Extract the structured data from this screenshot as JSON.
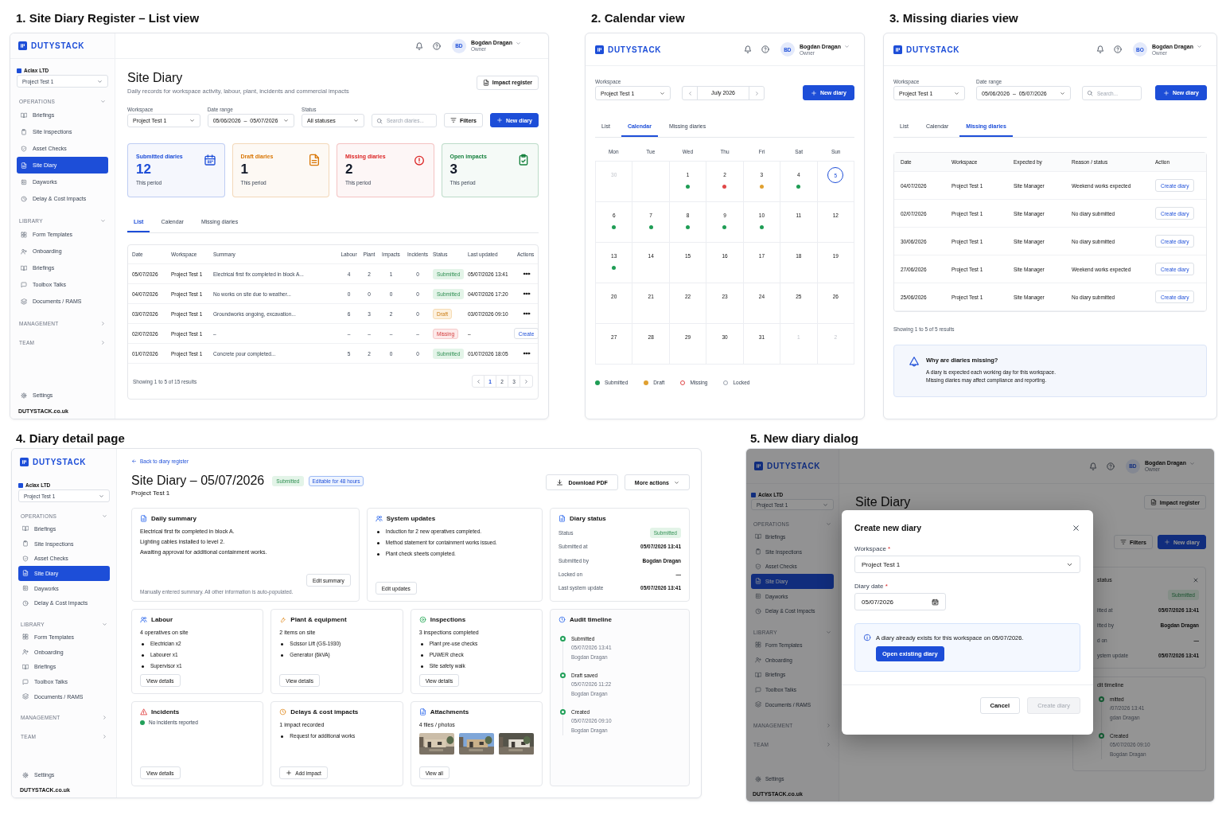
{
  "views": [
    {
      "kind": "list",
      "heading": "1. Site Diary Register – List view",
      "header": {
        "brand": "DUTYSTACK",
        "avatar": "BD",
        "user": "Bogdan Dragan",
        "role": "Owner"
      },
      "sidebar": {
        "org": "Aclax LTD",
        "project": "Project Test 1",
        "groups": [
          {
            "label": "OPERATIONS",
            "expanded": true,
            "items": [
              {
                "label": "Briefings",
                "selected": false
              },
              {
                "label": "Site Inspections",
                "selected": false
              },
              {
                "label": "Asset Checks",
                "selected": false
              },
              {
                "label": "Site Diary",
                "selected": true
              },
              {
                "label": "Dayworks",
                "selected": false
              },
              {
                "label": "Delay & Cost Impacts",
                "selected": false
              }
            ]
          },
          {
            "label": "LIBRARY",
            "expanded": true,
            "items": [
              {
                "label": "Form Templates",
                "selected": false
              },
              {
                "label": "Onboarding",
                "selected": false
              },
              {
                "label": "Briefings",
                "selected": false
              },
              {
                "label": "Toolbox Talks",
                "selected": false
              },
              {
                "label": "Documents / RAMS",
                "selected": false
              }
            ]
          },
          {
            "label": "MANAGEMENT",
            "expanded": false
          },
          {
            "label": "TEAM",
            "expanded": false
          }
        ],
        "settings": "Settings",
        "footer": "**DUTYSTACK**.co.uk"
      },
      "title": "Site Diary",
      "subtitle": "Daily records for workspace activity, labour, plant, incidents and commercial impacts",
      "impact_button": "Impact register",
      "filters": [
        {
          "label": "Workspace",
          "value": "Project Test 1"
        },
        {
          "label": "Date range",
          "value": "05/06/2026  –  05/07/2026"
        },
        {
          "label": "Status",
          "value": "All statuses"
        }
      ],
      "search": {
        "placeholder": "Search diaries..."
      },
      "filters_button": "Filters",
      "new_button": "New diary",
      "stats": [
        {
          "label": "Submitted diaries",
          "value": "12",
          "note": "This period",
          "color": "#1d4ed8"
        },
        {
          "label": "Draft diaries",
          "value": "1",
          "note": "This period",
          "color": "#d97706"
        },
        {
          "label": "Missing diaries",
          "value": "2",
          "note": "This period",
          "color": "#dc2626"
        },
        {
          "label": "Open impacts",
          "value": "3",
          "note": "This period",
          "color": "#15803d"
        }
      ],
      "tabs": [
        {
          "label": "List",
          "selected": true
        },
        {
          "label": "Calendar",
          "selected": false
        },
        {
          "label": "Missing diaries",
          "selected": false
        }
      ],
      "table": {
        "columns": [
          "Date",
          "Workspace",
          "Summary",
          "Labour",
          "Plant",
          "Impacts",
          "Incidents",
          "Status",
          "Last updated",
          "Actions"
        ],
        "rows": [
          {
            "cells": [
              "05/07/2026",
              "Project Test 1",
              "Electrical first fix completed in block A...",
              "4",
              "2",
              "1",
              "0"
            ],
            "status": {
              "kind": "submitted",
              "label": "Submitted"
            },
            "updated": "05/07/2026 13:41",
            "action": {
              "kind": "menu"
            }
          },
          {
            "cells": [
              "04/07/2026",
              "Project Test 1",
              "No works on site due to weather...",
              "0",
              "0",
              "0",
              "0"
            ],
            "status": {
              "kind": "submitted",
              "label": "Submitted"
            },
            "updated": "04/07/2026 17:20",
            "action": {
              "kind": "menu"
            }
          },
          {
            "cells": [
              "03/07/2026",
              "Project Test 1",
              "Groundworks ongoing, excavation...",
              "6",
              "3",
              "2",
              "0"
            ],
            "status": {
              "kind": "draft",
              "label": "Draft"
            },
            "updated": "03/07/2026 09:10",
            "action": {
              "kind": "menu"
            }
          },
          {
            "cells": [
              "02/07/2026",
              "Project Test 1",
              "–",
              "–",
              "–",
              "–",
              "–"
            ],
            "status": {
              "kind": "missing",
              "label": "Missing"
            },
            "updated": "–",
            "action": {
              "kind": "create",
              "label": "Create"
            }
          },
          {
            "cells": [
              "01/07/2026",
              "Project Test 1",
              "Concrete pour completed...",
              "5",
              "2",
              "0",
              "0"
            ],
            "status": {
              "kind": "submitted",
              "label": "Submitted"
            },
            "updated": "01/07/2026 18:05",
            "action": {
              "kind": "menu"
            }
          }
        ]
      },
      "results": "Showing 1 to 5 of 15 results",
      "pages": [
        {
          "label": "1",
          "selected": true
        },
        {
          "label": "2",
          "selected": false
        },
        {
          "label": "3",
          "selected": false
        }
      ]
    },
    {
      "kind": "calendar",
      "heading": "2. Calendar view",
      "header": {
        "brand": "DUTYSTACK",
        "avatar": "BD",
        "user": "Bogdan Dragan",
        "role": "Owner"
      },
      "workspace": {
        "label": "Workspace",
        "value": "Project Test 1"
      },
      "month": "July 2026",
      "new_button": "New diary",
      "tabs": [
        {
          "label": "List",
          "selected": false
        },
        {
          "label": "Calendar",
          "selected": true
        },
        {
          "label": "Missing diaries",
          "selected": false
        }
      ],
      "weekdays": [
        "Mon",
        "Tue",
        "Wed",
        "Thu",
        "Fri",
        "Sat",
        "Sun"
      ],
      "weeks": [
        [
          {
            "kind": "muted",
            "day": "30"
          },
          {
            "kind": "blank"
          },
          {
            "kind": "day",
            "day": "1",
            "color": "#1f9d55"
          },
          {
            "kind": "day",
            "day": "2",
            "color": "#e04848"
          },
          {
            "kind": "day",
            "day": "3",
            "color": "#e0a030"
          },
          {
            "kind": "day",
            "day": "4",
            "color": "#1f9d55"
          },
          {
            "kind": "today",
            "day": "5"
          }
        ],
        [
          {
            "kind": "day",
            "day": "6",
            "color": "#1f9d55"
          },
          {
            "kind": "day",
            "day": "7",
            "color": "#1f9d55"
          },
          {
            "kind": "day",
            "day": "8",
            "color": "#1f9d55"
          },
          {
            "kind": "day",
            "day": "9",
            "color": "#1f9d55"
          },
          {
            "kind": "day",
            "day": "10",
            "color": "#1f9d55"
          },
          {
            "kind": "day",
            "day": "11"
          },
          {
            "kind": "day",
            "day": "12"
          }
        ],
        [
          {
            "kind": "day",
            "day": "13",
            "color": "#1f9d55"
          },
          {
            "kind": "day",
            "day": "14"
          },
          {
            "kind": "day",
            "day": "15"
          },
          {
            "kind": "day",
            "day": "16"
          },
          {
            "kind": "day",
            "day": "17"
          },
          {
            "kind": "day",
            "day": "18"
          },
          {
            "kind": "day",
            "day": "19"
          }
        ],
        [
          {
            "kind": "day",
            "day": "20"
          },
          {
            "kind": "day",
            "day": "21"
          },
          {
            "kind": "day",
            "day": "22"
          },
          {
            "kind": "day",
            "day": "23"
          },
          {
            "kind": "day",
            "day": "24"
          },
          {
            "kind": "day",
            "day": "25"
          },
          {
            "kind": "day",
            "day": "26"
          }
        ],
        [
          {
            "kind": "day",
            "day": "27"
          },
          {
            "kind": "day",
            "day": "28"
          },
          {
            "kind": "day",
            "day": "29"
          },
          {
            "kind": "day",
            "day": "30"
          },
          {
            "kind": "day",
            "day": "31"
          },
          {
            "kind": "muted",
            "day": "1"
          },
          {
            "kind": "muted",
            "day": "2"
          }
        ]
      ],
      "legend": [
        {
          "label": "Submitted",
          "kind": "submitted"
        },
        {
          "label": "Draft",
          "kind": "draft"
        },
        {
          "label": "Missing",
          "kind": "missing"
        },
        {
          "label": "Locked",
          "kind": "locked"
        }
      ]
    },
    {
      "kind": "missing",
      "heading": "3. Missing diaries view",
      "header": {
        "brand": "DUTYSTACK",
        "avatar": "BO",
        "user": "Bogdan Dragan",
        "role": "Owner"
      },
      "workspace": {
        "label": "Workspace",
        "value": "Project Test 1"
      },
      "date_range": {
        "label": "Date range",
        "value": "05/06/2026  –  05/07/2026"
      },
      "search": {
        "placeholder": "Search..."
      },
      "new_button": "New diary",
      "tabs": [
        {
          "label": "List",
          "selected": false
        },
        {
          "label": "Calendar",
          "selected": false
        },
        {
          "label": "Missing diaries",
          "selected": true
        }
      ],
      "table": {
        "columns": [
          "Date",
          "Workspace",
          "Expected by",
          "Reason / status",
          "Action"
        ],
        "rows": [
          {
            "cells": [
              "04/07/2026",
              "Project Test 1",
              "Site Manager",
              "Weekend works expected"
            ],
            "action": "Create diary"
          },
          {
            "cells": [
              "02/07/2026",
              "Project Test 1",
              "Site Manager",
              "No diary submitted"
            ],
            "action": "Create diary"
          },
          {
            "cells": [
              "30/06/2026",
              "Project Test 1",
              "Site Manager",
              "No diary submitted"
            ],
            "action": "Create diary"
          },
          {
            "cells": [
              "27/06/2026",
              "Project Test 1",
              "Site Manager",
              "Weekend works expected"
            ],
            "action": "Create diary"
          },
          {
            "cells": [
              "25/06/2026",
              "Project Test 1",
              "Site Manager",
              "No diary submitted"
            ],
            "action": "Create diary"
          }
        ]
      },
      "results": "Showing 1 to 5 of 5 results",
      "info": {
        "title": "Why are diaries missing?",
        "lines": [
          "A diary is expected each working day for this workspace.",
          "Missing diaries may affect compliance and reporting."
        ]
      }
    },
    {
      "kind": "detail",
      "heading": "4. Diary detail page",
      "brand": "DUTYSTACK",
      "sidebar": {
        "org": "Aclax LTD",
        "project": "Project Test 1",
        "groups": [
          {
            "label": "OPERATIONS",
            "expanded": true,
            "items": [
              {
                "label": "Briefings",
                "selected": false
              },
              {
                "label": "Site Inspections",
                "selected": false
              },
              {
                "label": "Asset Checks",
                "selected": false
              },
              {
                "label": "Site Diary",
                "selected": true
              },
              {
                "label": "Dayworks",
                "selected": false
              },
              {
                "label": "Delay & Cost Impacts",
                "selected": false
              }
            ]
          },
          {
            "label": "LIBRARY",
            "expanded": true,
            "items": [
              {
                "label": "Form Templates",
                "selected": false
              },
              {
                "label": "Onboarding",
                "selected": false
              },
              {
                "label": "Briefings",
                "selected": false
              },
              {
                "label": "Toolbox Talks",
                "selected": false
              },
              {
                "label": "Documents / RAMS",
                "selected": false
              }
            ]
          },
          {
            "label": "MANAGEMENT",
            "expanded": false
          },
          {
            "label": "TEAM",
            "expanded": false
          }
        ],
        "settings": "Settings",
        "footer": "**DUTYSTACK**.co.uk"
      },
      "back_link": "Back to diary register",
      "title": "Site Diary – 05/07/2026",
      "badges": [
        {
          "label": "Submitted",
          "kind": "submitted"
        },
        {
          "label": "Editable for 48 hours",
          "kind": "info"
        }
      ],
      "subtitle": "Project Test 1",
      "actions": [
        {
          "label": "Download PDF",
          "kind": "download"
        },
        {
          "label": "More actions",
          "kind": "menu"
        }
      ],
      "summary": {
        "title": "Daily summary",
        "lines": [
          "Electrical first fix completed in block A.",
          "Lighting cables installed to level 2.",
          "Awaiting approval for additional containment works."
        ],
        "button": "Edit summary",
        "note": "Manually entered summary. All other information is auto-populated."
      },
      "system_updates": {
        "title": "System updates",
        "items": [
          "Induction for 2 new operatives completed.",
          "Method statement for containment works issued.",
          "Plant check sheets completed."
        ],
        "button": "Edit updates"
      },
      "status_card": {
        "title": "Diary status",
        "rows": [
          {
            "label": "Status",
            "badge": "Submitted"
          },
          {
            "label": "Submitted at",
            "value": "05/07/2026 13:41"
          },
          {
            "label": "Submitted by",
            "value": "Bogdan Dragan"
          },
          {
            "label": "Locked on",
            "value": "—"
          },
          {
            "label": "Last system update",
            "value": "05/07/2026 13:41"
          }
        ]
      },
      "cards": [
        {
          "kind": "labour",
          "title": "Labour",
          "count": "4 operatives on site",
          "items": [
            "Electrician x2",
            "Labourer x1",
            "Supervisor x1"
          ],
          "button": "View details"
        },
        {
          "kind": "plant",
          "title": "Plant & equipment",
          "count": "2 items on site",
          "items": [
            "Scissor Lift (GS-1930)",
            "Generator (6kVA)"
          ],
          "button": "View details"
        },
        {
          "kind": "inspections",
          "title": "Inspections",
          "count": "3 inspections completed",
          "items": [
            "Plant pre-use checks",
            "PUWER check",
            "Site safety walk"
          ],
          "button": "View details"
        },
        {
          "kind": "incidents",
          "title": "Incidents",
          "status": "No incidents reported",
          "button": "View details"
        },
        {
          "kind": "delays",
          "title": "Delays & cost impacts",
          "count": "1 impact recorded",
          "items": [
            "Request for additional works"
          ],
          "button": "Add impact"
        },
        {
          "kind": "attachments",
          "title": "Attachments",
          "count": "4 files / photos",
          "button": "View all"
        }
      ],
      "timeline": {
        "title": "Audit timeline",
        "events": [
          {
            "title": "Submitted",
            "time": "05/07/2026 13:41",
            "by": "Bogdan Dragan"
          },
          {
            "title": "Draft saved",
            "time": "05/07/2026 11:22",
            "by": "Bogdan Dragan"
          },
          {
            "title": "Created",
            "time": "05/07/2026 09:10",
            "by": "Bogdan Dragan"
          }
        ]
      }
    },
    {
      "kind": "dialog",
      "heading": "5. New diary dialog",
      "header": {
        "brand": "DUTYSTACK",
        "avatar": "BD",
        "user": "Bogdan Dragan",
        "role": "Owner"
      },
      "sidebar": {
        "org": "Aclax LTD",
        "project": "Project Test 1",
        "groups": [
          {
            "label": "OPERATIONS",
            "expanded": true,
            "items": [
              {
                "label": "Briefings",
                "selected": false
              },
              {
                "label": "Site Inspections",
                "selected": false
              },
              {
                "label": "Asset Checks",
                "selected": false
              },
              {
                "label": "Site Diary",
                "selected": true
              },
              {
                "label": "Dayworks",
                "selected": false
              },
              {
                "label": "Delay & Cost Impacts",
                "selected": false
              }
            ]
          },
          {
            "label": "LIBRARY",
            "expanded": true,
            "items": [
              {
                "label": "Form Templates",
                "selected": false
              },
              {
                "label": "Onboarding",
                "selected": false
              },
              {
                "label": "Briefings",
                "selected": false
              },
              {
                "label": "Toolbox Talks",
                "selected": false
              },
              {
                "label": "Documents / RAMS",
                "selected": false
              }
            ]
          },
          {
            "label": "MANAGEMENT",
            "expanded": false
          },
          {
            "label": "TEAM",
            "expanded": false
          }
        ],
        "settings": "Settings",
        "footer": "**DUTYSTACK**.co.uk"
      },
      "title": "Site Diary",
      "impact_button": "Impact register",
      "filters_button": "Filters",
      "new_button": "New diary",
      "behind": {
        "status_title": "status",
        "status_rows": [
          {
            "badge": "Submitted"
          },
          {
            "label": "itted at",
            "value": "05/07/2026 13:41"
          },
          {
            "label": "itted by",
            "value": "Bogdan Dragan"
          },
          {
            "label": "d on",
            "value": "—"
          },
          {
            "label": "ystem update",
            "value": "05/07/2026 13:41"
          }
        ],
        "timeline_title": "dit timeline",
        "events": [
          {
            "title": "mitted",
            "time": "/07/2026 13:41",
            "by": "gdan Dragan"
          },
          {
            "title": "Created",
            "time": "05/07/2026 09:10",
            "by": "Bogdan Dragan"
          }
        ]
      },
      "dialog": {
        "title": "Create new diary",
        "fields": [
          {
            "kind": "select",
            "label": "Workspace",
            "mark": "*",
            "value": "Project Test 1"
          },
          {
            "kind": "date",
            "label": "Diary date",
            "mark": "*",
            "value": "05/07/2026"
          }
        ],
        "notice": {
          "text": "A diary already exists for this workspace on 05/07/2026.",
          "button": "Open existing diary"
        },
        "buttons": [
          {
            "kind": "secondary",
            "label": "Cancel",
            "disabled": false
          },
          {
            "kind": "primary",
            "label": "Create diary",
            "disabled": true
          }
        ]
      }
    }
  ]
}
